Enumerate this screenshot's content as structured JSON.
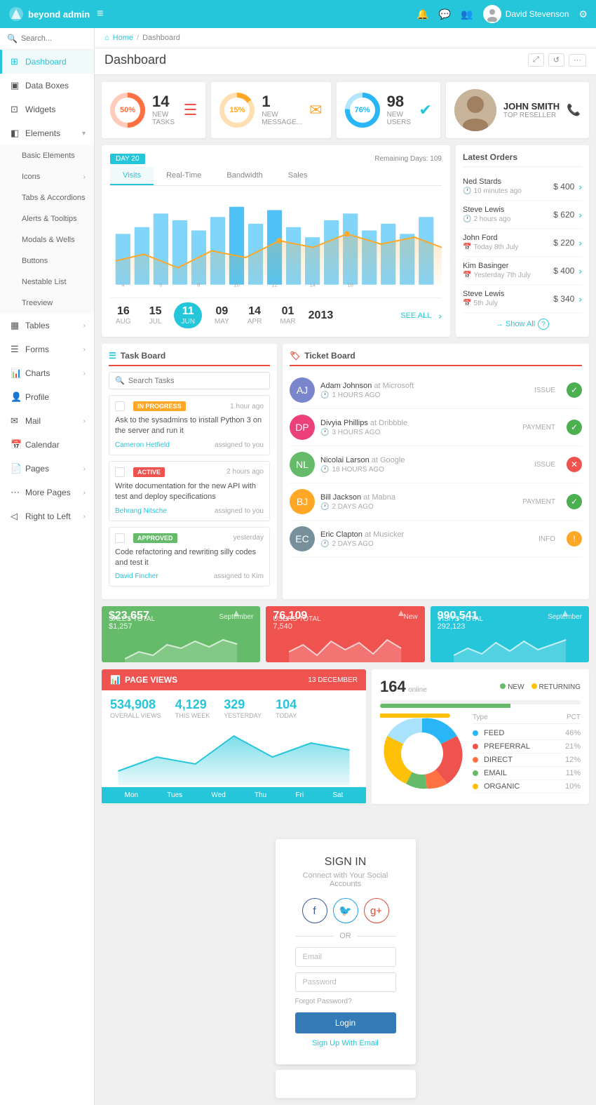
{
  "app": {
    "name": "beyond admin",
    "user": "David Stevenson"
  },
  "topnav": {
    "hamburger": "≡",
    "icons": [
      "🔔",
      "💬",
      "👥",
      "⚙"
    ]
  },
  "breadcrumb": {
    "home": "Home",
    "current": "Dashboard"
  },
  "page_title": "Dashboard",
  "stats": [
    {
      "percent": "50%",
      "number": "14",
      "label": "NEW TASKS",
      "icon": "☰",
      "icon_color": "red"
    },
    {
      "percent": "15%",
      "number": "1",
      "label": "NEW MESSAGE...",
      "icon": "✉",
      "icon_color": "orange"
    },
    {
      "percent": "76%",
      "number": "98",
      "label": "NEW USERS",
      "icon": "✔",
      "icon_color": "teal"
    }
  ],
  "reseller": {
    "name": "JOHN SMITH",
    "role": "TOP RESELLER"
  },
  "chart": {
    "day_badge": "DAY 20",
    "remaining": "Remaining Days: 109",
    "tabs": [
      "Visits",
      "Real-Time",
      "Bandwidth",
      "Sales"
    ],
    "active_tab": "Visits",
    "dates": [
      {
        "num": "16",
        "month": "AUG"
      },
      {
        "num": "15",
        "month": "JUL"
      },
      {
        "num": "11",
        "month": "JUN",
        "current": true
      },
      {
        "num": "09",
        "month": "MAY"
      },
      {
        "num": "14",
        "month": "APR"
      },
      {
        "num": "01",
        "month": "MAR"
      }
    ],
    "year": "2013",
    "see_all": "SEE ALL"
  },
  "latest_orders": {
    "title": "Latest Orders",
    "show_all": "→ Show All",
    "question_mark": "?",
    "orders": [
      {
        "name": "Ned Stards",
        "meta": "10 minutes ago",
        "amount": "$ 400"
      },
      {
        "name": "Steve Lewis",
        "meta": "2 hours ago",
        "amount": "$ 620"
      },
      {
        "name": "John Ford",
        "meta": "Today 8th July",
        "amount": "$ 220"
      },
      {
        "name": "Kim Basinger",
        "meta": "Yesterday 7th July",
        "amount": "$ 400"
      },
      {
        "name": "Steve Lewis",
        "meta": "5th July",
        "amount": "$ 340"
      }
    ]
  },
  "task_board": {
    "title": "Task Board",
    "search_placeholder": "Search Tasks",
    "tasks": [
      {
        "badge": "IN PROGRESS",
        "badge_class": "in-progress",
        "time": "1 hour ago",
        "text": "Ask to the sysadmins to install Python 3 on the server and run it",
        "author": "Cameron Hetfield",
        "assigned": "assigned to you"
      },
      {
        "badge": "ACTIVE",
        "badge_class": "active",
        "time": "2 hours ago",
        "text": "Write documentation for the new API with test and deploy specifications",
        "author": "Behrang Nitsche",
        "assigned": "assigned to you"
      },
      {
        "badge": "APPROVED",
        "badge_class": "approved",
        "time": "yesterday",
        "text": "Code refactoring and rewriting silly codes and test it",
        "author": "David Fincher",
        "assigned": "assigned to Kim"
      }
    ]
  },
  "ticket_board": {
    "title": "Ticket Board",
    "tickets": [
      {
        "name": "Adam Johnson",
        "company": "Microsoft",
        "time": "1 HOURS AGO",
        "type": "ISSUE",
        "status": "green",
        "color": "#4CAF50"
      },
      {
        "name": "Divyia Phillips",
        "company": "Dribbble",
        "time": "3 HOURS AGO",
        "type": "PAYMENT",
        "status": "green",
        "color": "#4CAF50"
      },
      {
        "name": "Nicolai Larson",
        "company": "Google",
        "time": "18 HOURS AGO",
        "type": "ISSUE",
        "status": "red",
        "color": "#ef5350"
      },
      {
        "name": "Bill Jackson",
        "company": "Mabna",
        "time": "2 DAYS AGO",
        "type": "PAYMENT",
        "status": "green",
        "color": "#4CAF50"
      },
      {
        "name": "Eric Clapton",
        "company": "Musicker",
        "time": "2 DAYS AGO",
        "type": "INFO",
        "status": "yellow",
        "color": "#FFA726"
      }
    ]
  },
  "mini_stats": [
    {
      "label": "Sales Total",
      "month": "September",
      "value": "$23,657",
      "sub": "$1,257",
      "card_class": "green-card"
    },
    {
      "label": "Users Total",
      "month": "New",
      "value": "76,109",
      "sub": "7,540",
      "card_class": "orange-card"
    },
    {
      "label": "Visits Total",
      "month": "September",
      "value": "990,541",
      "sub": "292,123",
      "card_class": "teal-card"
    }
  ],
  "page_views": {
    "title": "PAGE VIEWS",
    "date": "13 DECEMBER",
    "stats": [
      {
        "num": "534,908",
        "label": "OVERALL VIEWS"
      },
      {
        "num": "4,129",
        "label": "THIS WEEK"
      },
      {
        "num": "329",
        "label": "YESTERDAY"
      },
      {
        "num": "104",
        "label": "TODAY"
      }
    ],
    "days": [
      "Mon",
      "Tues",
      "Wed",
      "Thu",
      "Fri",
      "Sat"
    ]
  },
  "donut": {
    "online": "164",
    "online_label": "online",
    "new_label": "NEW",
    "returning_label": "RETURNING",
    "chart_title": "Type",
    "chart_pct": "PCT",
    "rows": [
      {
        "label": "FEED",
        "pct": "46%",
        "color": "#29B6F6"
      },
      {
        "label": "PREFERRAL",
        "pct": "21%",
        "color": "#EF5350"
      },
      {
        "label": "DIRECT",
        "pct": "12%",
        "color": "#FF7043"
      },
      {
        "label": "EMAIL",
        "pct": "11%",
        "color": "#66BB6A"
      },
      {
        "label": "ORGANIC",
        "pct": "10%",
        "color": "#FFC107"
      }
    ]
  },
  "signin": {
    "title": "SIGN IN",
    "subtitle": "Connect with Your Social Accounts",
    "or": "OR",
    "email_placeholder": "Email",
    "password_placeholder": "Password",
    "forgot": "Forgot Password?",
    "login_btn": "Login",
    "signup": "Sign Up With Email"
  },
  "sidebar": {
    "items": [
      {
        "label": "Dashboard",
        "icon": "⊞",
        "active": true
      },
      {
        "label": "Data Boxes",
        "icon": "▣"
      },
      {
        "label": "Widgets",
        "icon": "⊡"
      },
      {
        "label": "Elements",
        "icon": "◧",
        "has_arrow": true,
        "expanded": true
      },
      {
        "label": "Basic Elements",
        "submenu": true
      },
      {
        "label": "Icons",
        "submenu": true,
        "has_arrow": true
      },
      {
        "label": "Tabs & Accordions",
        "submenu": true
      },
      {
        "label": "Alerts & Tooltips",
        "submenu": true
      },
      {
        "label": "Modals & Wells",
        "submenu": true
      },
      {
        "label": "Buttons",
        "submenu": true
      },
      {
        "label": "Nestable List",
        "submenu": true
      },
      {
        "label": "Treeview",
        "submenu": true
      },
      {
        "label": "Tables",
        "icon": "▦",
        "has_arrow": true
      },
      {
        "label": "Forms",
        "icon": "☰",
        "has_arrow": true
      },
      {
        "label": "Charts",
        "icon": "📊",
        "has_arrow": true
      },
      {
        "label": "Profile",
        "icon": "👤"
      },
      {
        "label": "Mail",
        "icon": "✉",
        "has_arrow": true
      },
      {
        "label": "Calendar",
        "icon": "📅"
      },
      {
        "label": "Pages",
        "icon": "📄",
        "has_arrow": true
      },
      {
        "label": "More Pages",
        "icon": "⋯",
        "has_arrow": true
      },
      {
        "label": "Right to Left",
        "icon": "◁",
        "has_arrow": true
      }
    ]
  }
}
